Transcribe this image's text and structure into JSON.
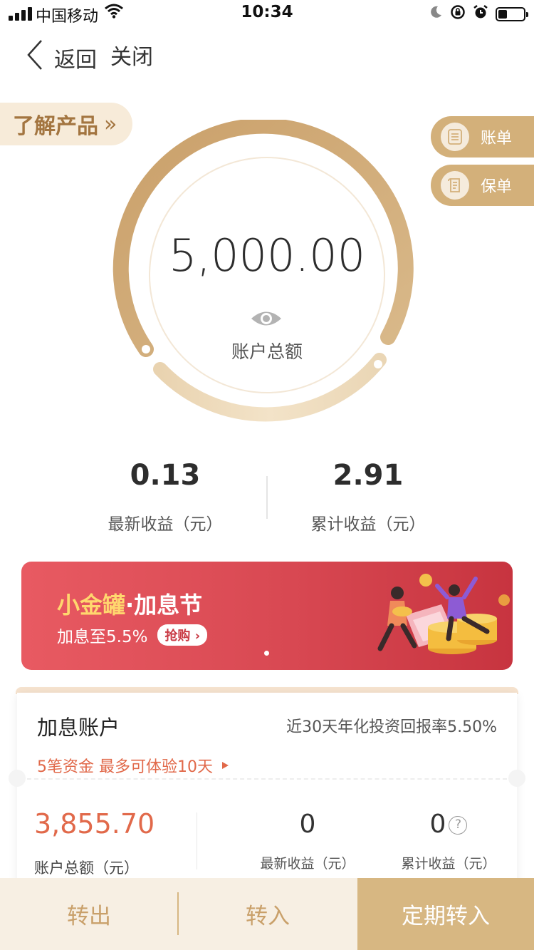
{
  "status_bar": {
    "carrier": "中国移动",
    "time": "10:34"
  },
  "nav": {
    "back_label": "返回",
    "close_label": "关闭"
  },
  "learn_product": {
    "label": "了解产品",
    "chevron": "»"
  },
  "side_buttons": [
    {
      "label": "账单",
      "icon": "bill-icon"
    },
    {
      "label": "保单",
      "icon": "policy-icon"
    }
  ],
  "balance": {
    "amount": "5,000.00",
    "label": "账户总额"
  },
  "earnings": {
    "latest": {
      "value": "0.13",
      "label": "最新收益（元）"
    },
    "total": {
      "value": "2.91",
      "label": "累计收益（元）"
    }
  },
  "banner": {
    "title_a": "小金罐",
    "title_sep": "·",
    "title_b": "加息节",
    "subtitle": "加息至5.5%",
    "cta": "抢购 ›"
  },
  "bonus_account": {
    "title": "加息账户",
    "rate_text": "近30天年化投资回报率5.50%",
    "note": "5笔资金  最多可体验10天",
    "total": {
      "value": "3,855.70",
      "label": "账户总额（元）"
    },
    "latest": {
      "value": "0",
      "label": "最新收益（元）"
    },
    "cumulative": {
      "value": "0",
      "label": "累计收益（元）"
    }
  },
  "footer": {
    "transfer_out": "转出",
    "transfer_in": "转入",
    "fixed_in": "定期转入"
  },
  "colors": {
    "gold": "#d3b07a",
    "red": "#d84852",
    "orange": "#e1694a"
  }
}
